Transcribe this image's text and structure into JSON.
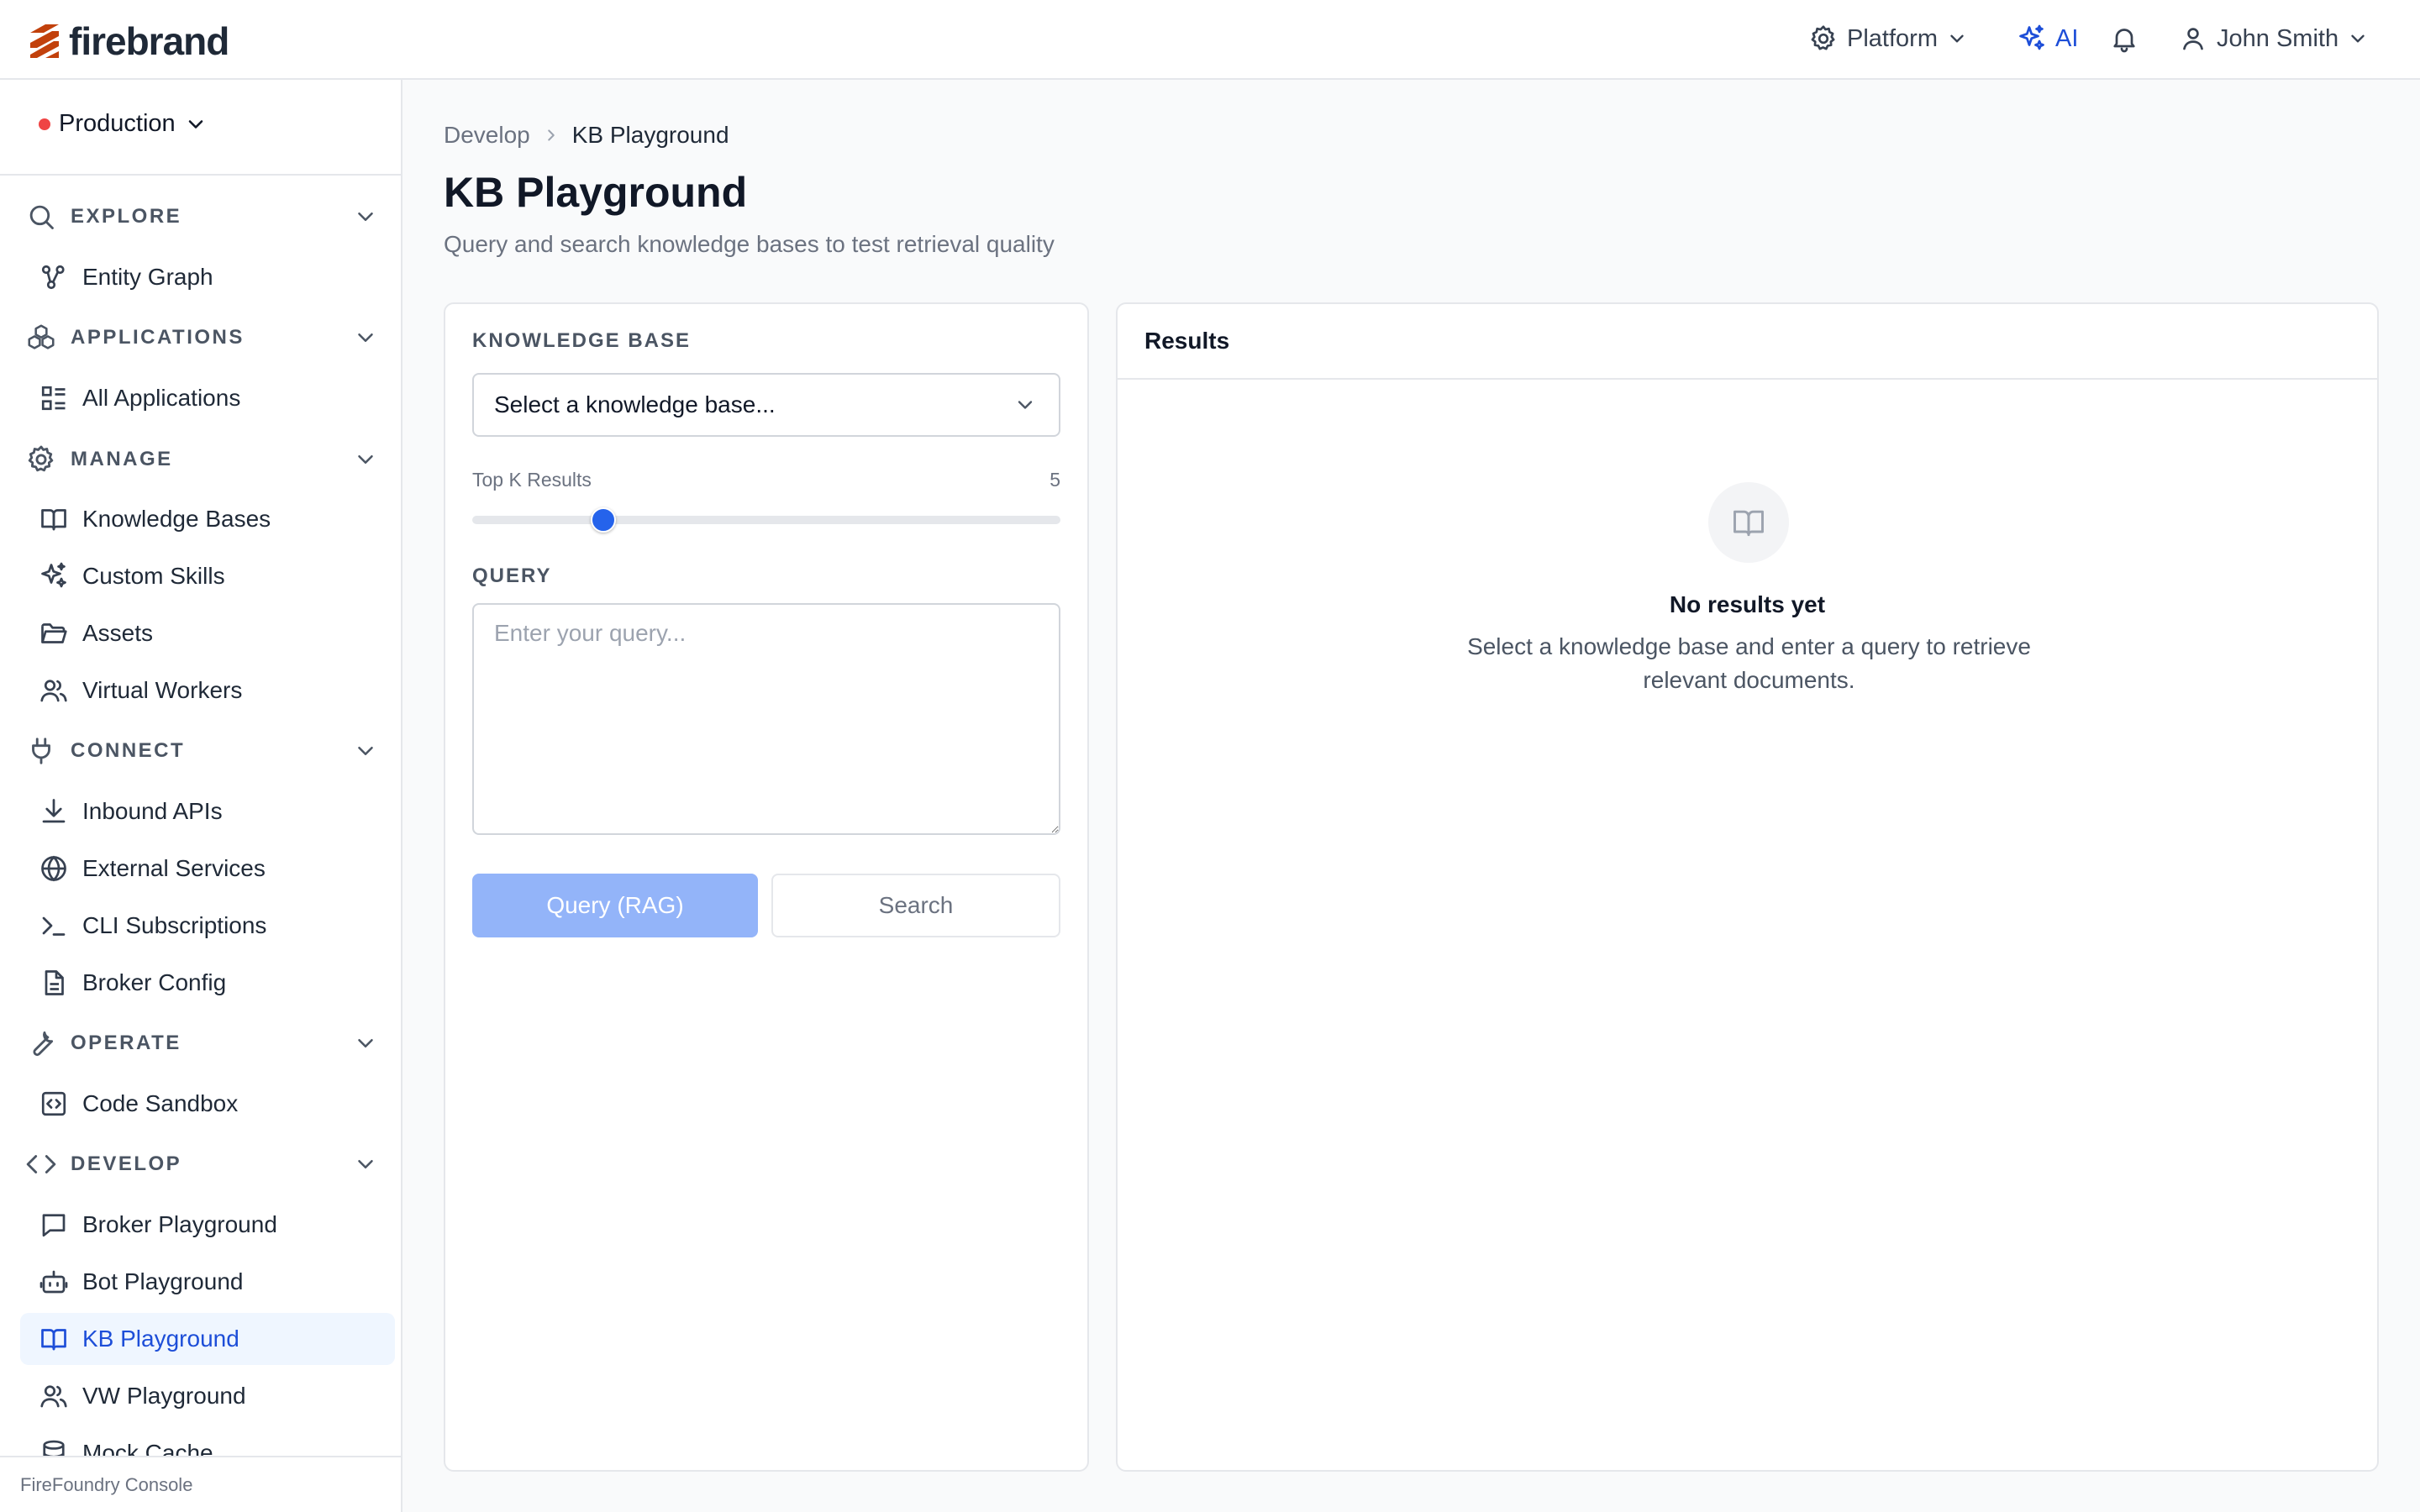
{
  "header": {
    "brand": "firebrand",
    "platform_label": "Platform",
    "ai_label": "AI",
    "user_name": "John Smith",
    "accent_color": "#1d4ed8",
    "brand_color": "#c2410c"
  },
  "sidebar": {
    "environment": "Production",
    "environment_status_color": "#ef4444",
    "sections": {
      "explore": {
        "label": "EXPLORE",
        "icon": "search-icon"
      },
      "applications": {
        "label": "APPLICATIONS",
        "icon": "cubes-icon"
      },
      "manage": {
        "label": "MANAGE",
        "icon": "gear-icon"
      },
      "connect": {
        "label": "CONNECT",
        "icon": "plug-icon"
      },
      "operate": {
        "label": "OPERATE",
        "icon": "wrench-icon"
      },
      "develop": {
        "label": "DEVELOP",
        "icon": "code-icon"
      }
    },
    "items": {
      "entity_graph": {
        "label": "Entity Graph",
        "icon": "graph-icon"
      },
      "all_applications": {
        "label": "All Applications",
        "icon": "grid-list-icon"
      },
      "knowledge_bases": {
        "label": "Knowledge Bases",
        "icon": "book-icon"
      },
      "custom_skills": {
        "label": "Custom Skills",
        "icon": "sparkles-icon"
      },
      "assets": {
        "label": "Assets",
        "icon": "folder-icon"
      },
      "virtual_workers": {
        "label": "Virtual Workers",
        "icon": "users-icon"
      },
      "inbound_apis": {
        "label": "Inbound APIs",
        "icon": "download-icon"
      },
      "external_services": {
        "label": "External Services",
        "icon": "globe-icon"
      },
      "cli_subscriptions": {
        "label": "CLI Subscriptions",
        "icon": "terminal-icon"
      },
      "broker_config": {
        "label": "Broker Config",
        "icon": "file-icon"
      },
      "code_sandbox": {
        "label": "Code Sandbox",
        "icon": "code-box-icon"
      },
      "broker_playground": {
        "label": "Broker Playground",
        "icon": "chat-icon"
      },
      "bot_playground": {
        "label": "Bot Playground",
        "icon": "bot-icon"
      },
      "kb_playground": {
        "label": "KB Playground",
        "icon": "book-icon",
        "active": true
      },
      "vw_playground": {
        "label": "VW Playground",
        "icon": "users-icon"
      },
      "mock_cache": {
        "label": "Mock Cache",
        "icon": "database-icon"
      }
    },
    "footer": "FireFoundry Console"
  },
  "breadcrumb": {
    "parent": "Develop",
    "current": "KB Playground"
  },
  "page": {
    "title": "KB Playground",
    "subtitle": "Query and search knowledge bases to test retrieval quality"
  },
  "query_panel": {
    "kb_label": "KNOWLEDGE BASE",
    "kb_select_value": "Select a knowledge base...",
    "topk_label": "Top K Results",
    "topk_value": 5,
    "topk_min": 1,
    "topk_max": 20,
    "query_label": "QUERY",
    "query_placeholder": "Enter your query...",
    "query_value": "",
    "rag_button": "Query (RAG)",
    "search_button": "Search"
  },
  "results_panel": {
    "title": "Results",
    "empty_title": "No results yet",
    "empty_text": "Select a knowledge base and enter a query to retrieve relevant documents."
  }
}
